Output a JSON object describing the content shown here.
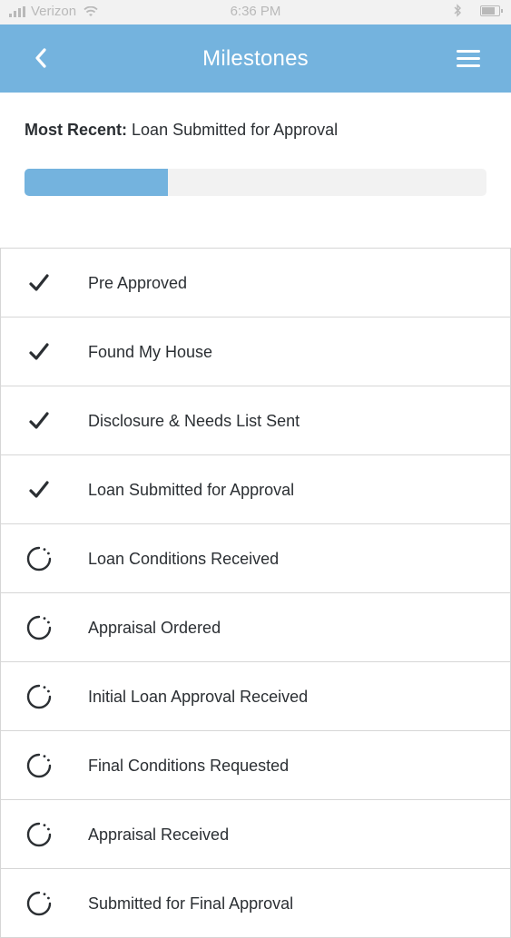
{
  "status_bar": {
    "carrier": "Verizon",
    "time": "6:36 PM"
  },
  "nav": {
    "title": "Milestones",
    "back_icon": "chevron-left-icon",
    "menu_icon": "hamburger-menu-icon"
  },
  "most_recent": {
    "label": "Most Recent:",
    "value": "Loan Submitted for Approval"
  },
  "progress": {
    "fraction": 0.31,
    "color": "#74b3de",
    "track_color": "#f2f2f2"
  },
  "colors": {
    "accent": "#74b3de",
    "text": "#2b2f33",
    "divider": "#d6d6d6"
  },
  "milestones": [
    {
      "label": "Pre Approved",
      "status": "complete",
      "icon": "checkmark-icon"
    },
    {
      "label": "Found My House",
      "status": "complete",
      "icon": "checkmark-icon"
    },
    {
      "label": "Disclosure & Needs List Sent",
      "status": "complete",
      "icon": "checkmark-icon"
    },
    {
      "label": "Loan Submitted for Approval",
      "status": "complete",
      "icon": "checkmark-icon"
    },
    {
      "label": "Loan Conditions Received",
      "status": "pending",
      "icon": "pending-spinner-icon"
    },
    {
      "label": "Appraisal Ordered",
      "status": "pending",
      "icon": "pending-spinner-icon"
    },
    {
      "label": "Initial Loan Approval Received",
      "status": "pending",
      "icon": "pending-spinner-icon"
    },
    {
      "label": "Final Conditions Requested",
      "status": "pending",
      "icon": "pending-spinner-icon"
    },
    {
      "label": "Appraisal Received",
      "status": "pending",
      "icon": "pending-spinner-icon"
    },
    {
      "label": "Submitted for Final Approval",
      "status": "pending",
      "icon": "pending-spinner-icon"
    }
  ]
}
